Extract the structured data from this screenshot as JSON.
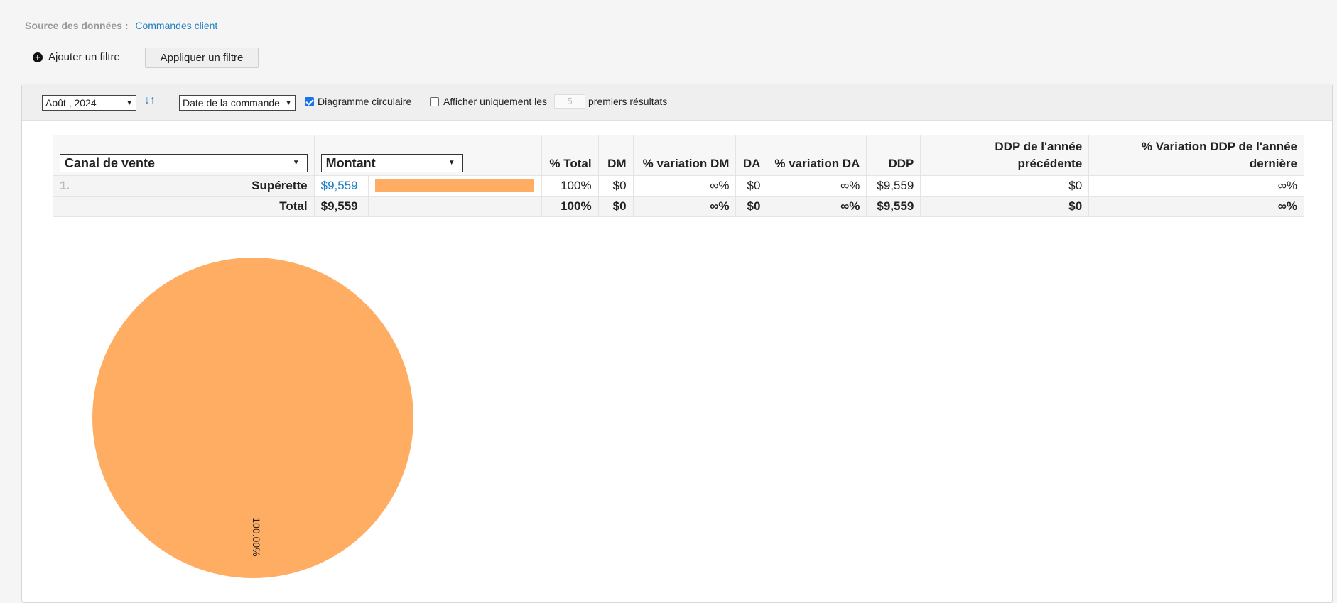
{
  "source": {
    "label": "Source des données :",
    "value": "Commandes client"
  },
  "filters": {
    "add_label": "Ajouter un filtre",
    "apply_label": "Appliquer un filtre"
  },
  "toolbar": {
    "period": "Août , 2024",
    "date_field": "Date de la commande",
    "pie_label": "Diagramme circulaire",
    "pie_checked": true,
    "topn_label_before": "Afficher uniquement les",
    "topn_value": "5",
    "topn_label_after": "premiers résultats",
    "topn_checked": false
  },
  "table": {
    "group_by": "Canal de vente",
    "measure": "Montant",
    "headers": {
      "pct_total": "% Total",
      "dm": "DM",
      "pct_dm": "% variation DM",
      "da": "DA",
      "pct_da": "% variation DA",
      "ddp": "DDP",
      "ddp_prev": "DDP de l'année précédente",
      "pct_ddp_prev": "% Variation DDP de l'année dernière"
    },
    "rows": [
      {
        "rank": "1.",
        "name": "Supérette",
        "amount": "$9,559",
        "bar_fraction": 1.0,
        "pct_total": "100%",
        "dm": "$0",
        "pct_dm": "∞%",
        "da": "$0",
        "pct_da": "∞%",
        "ddp": "$9,559",
        "ddp_prev": "$0",
        "pct_ddp_prev": "∞%"
      }
    ],
    "total": {
      "label": "Total",
      "amount": "$9,559",
      "pct_total": "100%",
      "dm": "$0",
      "pct_dm": "∞%",
      "da": "$0",
      "pct_da": "∞%",
      "ddp": "$9,559",
      "ddp_prev": "$0",
      "pct_ddp_prev": "∞%"
    }
  },
  "chart_data": {
    "type": "pie",
    "categories": [
      "Supérette"
    ],
    "values": [
      100
    ],
    "slice_labels": [
      "100.00%"
    ],
    "colors": [
      "#ffad62"
    ]
  }
}
